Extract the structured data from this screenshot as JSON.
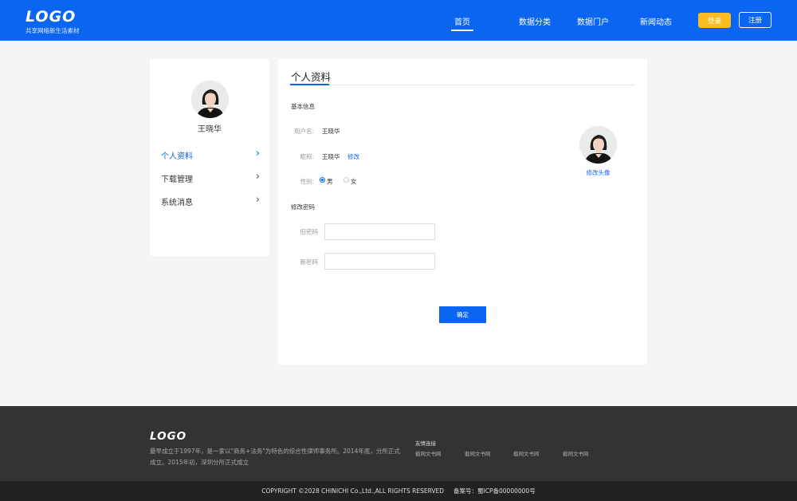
{
  "header": {
    "logo": "LOGO",
    "tagline": "共享网络新生活素材",
    "nav": [
      "首页",
      "数据分类",
      "数据门户",
      "新闻动态"
    ],
    "login": "登录",
    "register": "注册",
    "brand_color": "#0a65f0",
    "login_color": "#fbbd22"
  },
  "sidebar": {
    "username": "王晓华",
    "avatar_icon": "user-photo",
    "items": [
      {
        "label": "个人资料",
        "icon": "chevron-right-icon",
        "active": true
      },
      {
        "label": "下载管理",
        "icon": "chevron-right-icon",
        "active": false
      },
      {
        "label": "系统消息",
        "icon": "chevron-right-icon",
        "active": false
      }
    ]
  },
  "main": {
    "title": "个人资料",
    "basic_section": "基本信息",
    "username_label": "用户名:",
    "username_value": "王晓华",
    "nickname_label": "昵称:",
    "nickname_value": "王晓华",
    "nickname_edit": "修改",
    "gender_label": "性别:",
    "gender_options": [
      "男",
      "女"
    ],
    "gender_selected": "男",
    "password_section": "修改密码",
    "old_password_label": "旧密码",
    "old_password_value": "",
    "new_password_label": "新密码",
    "new_password_value": "",
    "change_avatar": "修改头像",
    "confirm": "确定"
  },
  "footer": {
    "logo": "LOGO",
    "description": "最早成立于1997年，是一家以\"商务+法务\"为特色的综合性律师事务所。2014年底，分所正式成立。2015年初，深圳分所正式成立",
    "links_title": "友情连接",
    "links": [
      "截网文书网",
      "截网文书网",
      "截网文书网",
      "截网文书网"
    ],
    "copyright": "COPYRIGHT ©2028 CHINICHI Co.,Ltd.,ALL RIGHTS RESERVED",
    "icp": "备案号：蜀ICP备00000000号"
  }
}
